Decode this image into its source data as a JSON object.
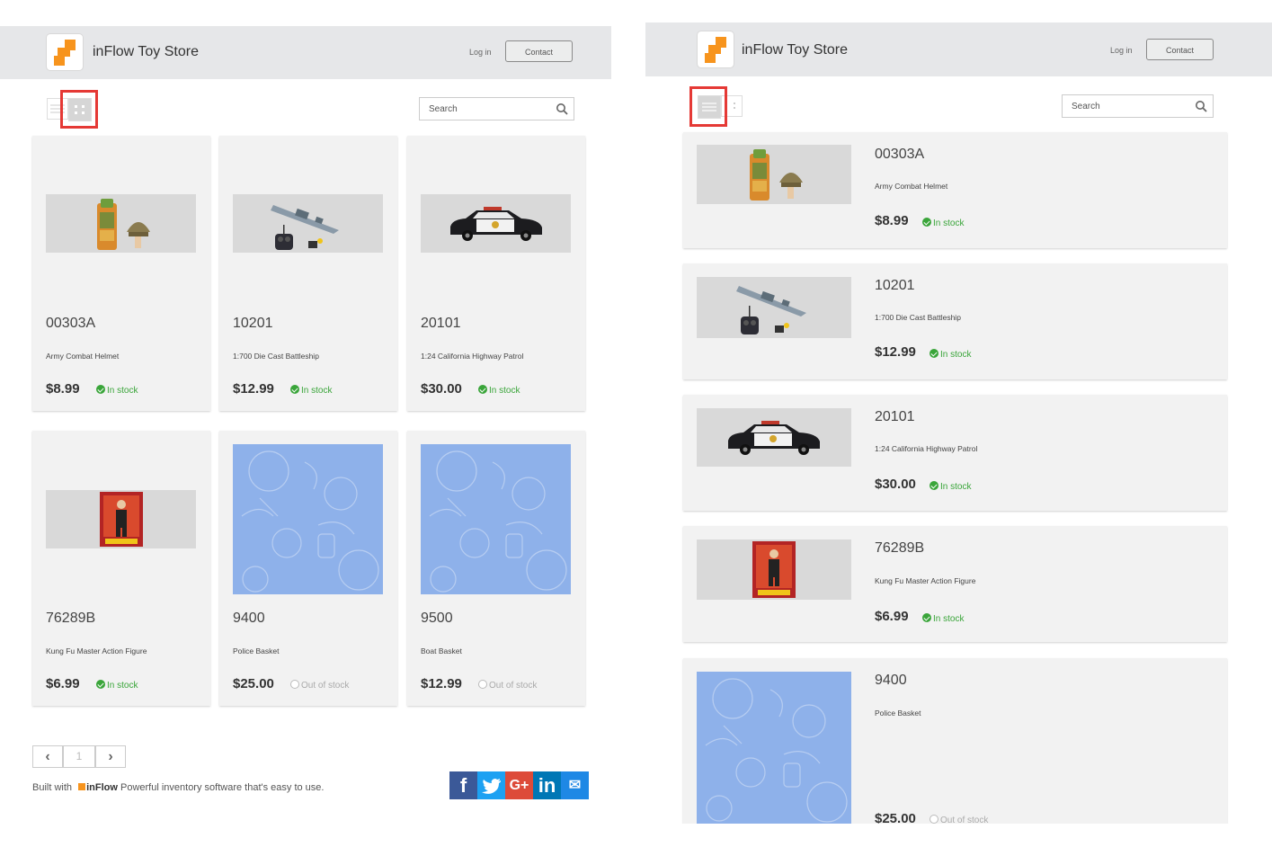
{
  "store": {
    "name": "inFlow Toy Store",
    "login_label": "Log in",
    "contact_label": "Contact",
    "search_placeholder": "Search"
  },
  "products": [
    {
      "sku": "00303A",
      "name": "Army Combat Helmet",
      "price": "$8.99",
      "stock": "In stock",
      "in_stock": true,
      "image": "helmet-product-photo"
    },
    {
      "sku": "10201",
      "name": "1:700 Die Cast Battleship",
      "price": "$12.99",
      "stock": "In stock",
      "in_stock": true,
      "image": "battleship-product-photo"
    },
    {
      "sku": "20101",
      "name": "1:24 California Highway Patrol",
      "price": "$30.00",
      "stock": "In stock",
      "in_stock": true,
      "image": "police-car-product-photo"
    },
    {
      "sku": "76289B",
      "name": "Kung Fu Master Action Figure",
      "price": "$6.99",
      "stock": "In stock",
      "in_stock": true,
      "image": "action-figure-product-photo"
    },
    {
      "sku": "9400",
      "name": "Police Basket",
      "price": "$25.00",
      "stock": "Out of stock",
      "in_stock": false,
      "image": "placeholder-pattern"
    },
    {
      "sku": "9500",
      "name": "Boat Basket",
      "price": "$12.99",
      "stock": "Out of stock",
      "in_stock": false,
      "image": "placeholder-pattern"
    }
  ],
  "pagination": {
    "prev": "‹",
    "current": "1",
    "next": "›"
  },
  "footer": {
    "built_with": "Built with",
    "brand": "inFlow",
    "tagline": "Powerful inventory software that's easy to use."
  },
  "social": [
    {
      "label": "f",
      "icon": "facebook-icon",
      "color": "#3b5998"
    },
    {
      "label": "t",
      "icon": "twitter-icon",
      "color": "#1da1f2"
    },
    {
      "label": "G+",
      "icon": "google-plus-icon",
      "color": "#dd4b39"
    },
    {
      "label": "in",
      "icon": "linkedin-icon",
      "color": "#0077b5"
    },
    {
      "label": "✉",
      "icon": "email-icon",
      "color": "#1e88e5"
    }
  ],
  "colors": {
    "accent": "#f7941d",
    "in_stock": "#3aa53a",
    "highlight": "#e53935",
    "header_bg": "#e6e7e9"
  }
}
